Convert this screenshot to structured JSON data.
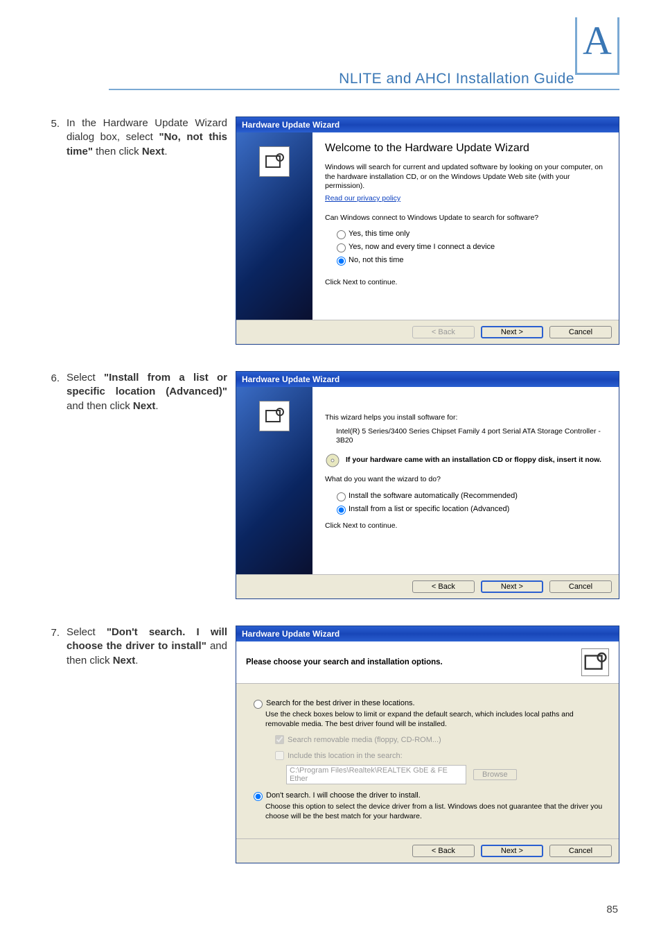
{
  "header": {
    "title": "NLITE and AHCI Installation Guide",
    "appendix_letter": "A"
  },
  "steps": [
    {
      "num": "5.",
      "text_parts": [
        "In the Hardware Update Wizard dialog box, select ",
        "\"No, not this time\"",
        " then click ",
        "Next",
        "."
      ]
    },
    {
      "num": "6.",
      "text_parts": [
        "Select ",
        "\"Install from a list or specific location (Advanced)\"",
        " and then click ",
        "Next",
        "."
      ]
    },
    {
      "num": "7.",
      "text_parts": [
        "Select ",
        "\"Don't search. I will choose the driver to install\"",
        " and then click ",
        "Next",
        "."
      ]
    }
  ],
  "wizard1": {
    "title": "Hardware Update Wizard",
    "heading": "Welcome to the Hardware Update Wizard",
    "para": "Windows will search for current and updated software by looking on your computer, on the hardware installation CD, or on the Windows Update Web site (with your permission).",
    "link": "Read our privacy policy",
    "question": "Can Windows connect to Windows Update to search for software?",
    "opt1": "Yes, this time only",
    "opt2": "Yes, now and every time I connect a device",
    "opt3": "No, not this time",
    "continue": "Click Next to continue.",
    "back": "< Back",
    "next": "Next >",
    "cancel": "Cancel"
  },
  "wizard2": {
    "title": "Hardware Update Wizard",
    "intro": "This wizard helps you install software for:",
    "device": "Intel(R) 5 Series/3400 Series Chipset Family 4 port Serial ATA Storage Controller - 3B20",
    "cd_hint": "If your hardware came with an installation CD or floppy disk, insert it now.",
    "question": "What do you want the wizard to do?",
    "opt1": "Install the software automatically (Recommended)",
    "opt2": "Install from a list or specific location (Advanced)",
    "continue": "Click Next to continue.",
    "back": "< Back",
    "next": "Next >",
    "cancel": "Cancel"
  },
  "wizard3": {
    "title": "Hardware Update Wizard",
    "heading": "Please choose your search and installation options.",
    "opt1": "Search for the best driver in these locations.",
    "opt1_desc": "Use the check boxes below to limit or expand the default search, which includes local paths and removable media. The best driver found will be installed.",
    "chk1": "Search removable media (floppy, CD-ROM...)",
    "chk2": "Include this location in the search:",
    "path": "C:\\Program Files\\Realtek\\REALTEK GbE & FE Ether",
    "browse": "Browse",
    "opt2": "Don't search. I will choose the driver to install.",
    "opt2_desc": "Choose this option to select the device driver from a list. Windows does not guarantee that the driver you choose will be the best match for your hardware.",
    "back": "< Back",
    "next": "Next >",
    "cancel": "Cancel"
  },
  "page_number": "85"
}
